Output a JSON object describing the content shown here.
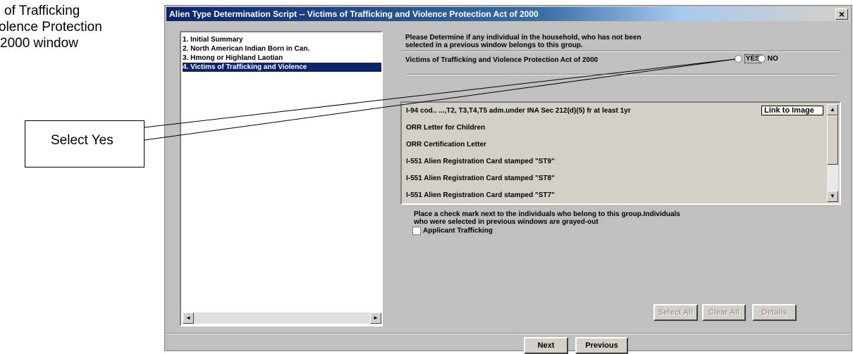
{
  "caption": {
    "lines": [
      "of Trafficking",
      "olence Protection",
      "2000 window"
    ]
  },
  "callout": {
    "label": "Select Yes"
  },
  "window": {
    "title": "Alien Type Determination Script -- Victims of Trafficking and Violence Protection Act of 2000",
    "close_label": "×"
  },
  "nav": {
    "items": [
      {
        "label": "1.   Initial Summary"
      },
      {
        "label": "2.   North American Indian Born in Can."
      },
      {
        "label": "3.   Hmong or Highland Laotian"
      },
      {
        "label": "4.   Victims of Trafficking and Violence"
      }
    ],
    "selected_index": 3
  },
  "prompt": {
    "line1": "Please Determine if any individual in the household, who has not been",
    "line2": "selected in a previous window belongs to this group.",
    "question": "Victims of Trafficking and Violence Protection Act of 2000",
    "yes_label": "YES",
    "no_label": "NO"
  },
  "documents": [
    {
      "label": "I-94 cod.. ...,T2, T3,T4,T5 adm.under INA Sec 212(d)(5) fr at least 1yr"
    },
    {
      "label": "ORR Letter for Children"
    },
    {
      "label": "ORR Certification Letter"
    },
    {
      "label": "I-551 Alien Registration Card stamped \"ST9\""
    },
    {
      "label": "I-551 Alien Registration Card stamped \"ST8\""
    },
    {
      "label": "I-551 Alien Registration Card stamped \"ST7\""
    }
  ],
  "link_to_image_label": "Link to Image",
  "instructions": {
    "line1": "Place a check mark next to the individuals who belong to this group.Individuals",
    "line2": "who were selected in previous windows are grayed-out"
  },
  "individuals": [
    {
      "label": "Applicant Trafficking",
      "checked": false
    }
  ],
  "actions": {
    "select_all": "Select All",
    "clear_all": "Clear All",
    "details": "Details"
  },
  "footer": {
    "next": "Next",
    "previous": "Previous"
  }
}
